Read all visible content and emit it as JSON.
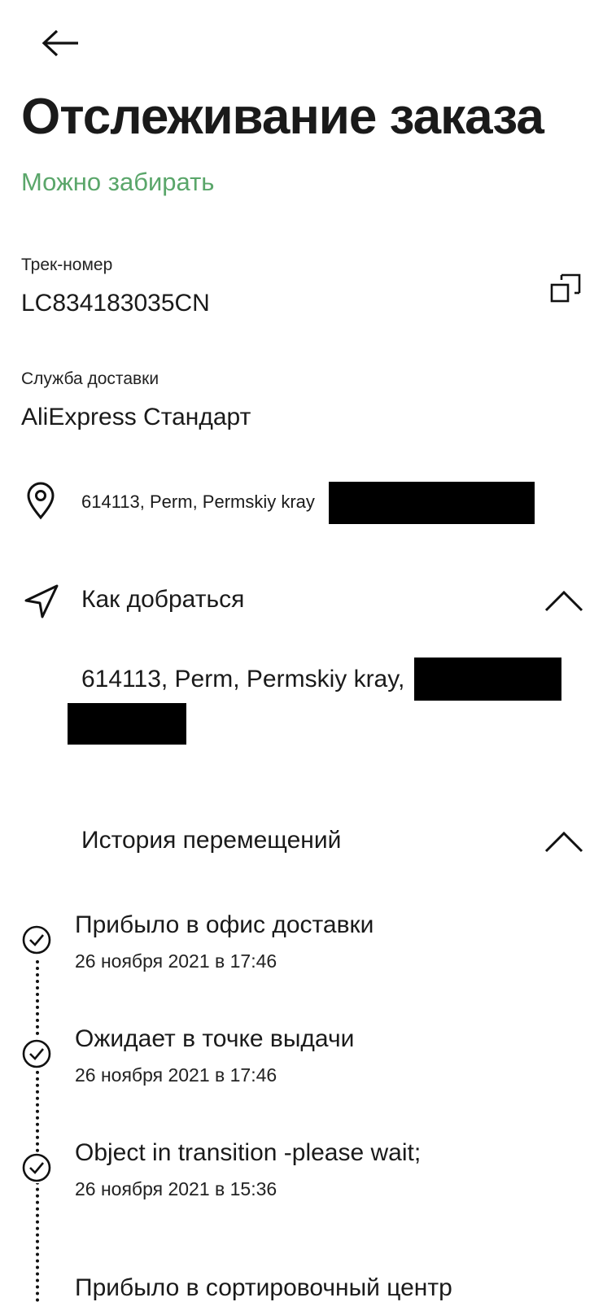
{
  "header": {
    "title": "Отслеживание заказа",
    "status": "Можно забирать",
    "status_color": "#5aa66a",
    "back_icon": "arrow-left-icon"
  },
  "tracking": {
    "label": "Трек-номер",
    "number": "LC834183035CN",
    "copy_icon": "copy-icon"
  },
  "delivery": {
    "label": "Служба доставки",
    "service": "AliExpress Стандарт"
  },
  "pickup": {
    "icon": "location-pin-icon",
    "address": "614113, Perm, Permskiy kray"
  },
  "directions": {
    "icon": "navigation-arrow-icon",
    "label": "Как добраться",
    "address": "614113, Perm, Permskiy kray,",
    "expanded": true
  },
  "history": {
    "label": "История перемещений",
    "expanded": true,
    "events": [
      {
        "title": "Прибыло в офис доставки",
        "date": "26 ноября 2021 в 17:46"
      },
      {
        "title": "Ожидает в точке выдачи",
        "date": "26 ноября 2021 в 17:46"
      },
      {
        "title": "Object in transition -please wait;",
        "date": "26 ноября 2021 в 15:36"
      },
      {
        "title": "Прибыло в сортировочный центр",
        "date": ""
      }
    ]
  }
}
